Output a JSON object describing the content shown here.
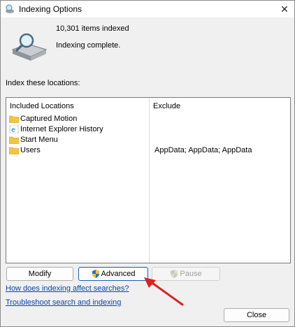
{
  "window": {
    "title": "Indexing Options",
    "close_glyph": "✕"
  },
  "status": {
    "items_indexed": "10,301 items indexed",
    "state": "Indexing complete."
  },
  "locations": {
    "label": "Index these locations:",
    "headers": {
      "included": "Included Locations",
      "exclude": "Exclude"
    },
    "rows": [
      {
        "name": "Captured Motion",
        "icon": "folder-icon",
        "exclude": ""
      },
      {
        "name": "Internet Explorer History",
        "icon": "internet-explorer-icon",
        "exclude": ""
      },
      {
        "name": "Start Menu",
        "icon": "folder-icon",
        "exclude": ""
      },
      {
        "name": "Users",
        "icon": "folder-icon",
        "exclude": "AppData; AppData; AppData"
      }
    ]
  },
  "buttons": {
    "modify": "Modify",
    "advanced": "Advanced",
    "pause": "Pause",
    "close": "Close"
  },
  "links": {
    "affect": "How does indexing affect searches?",
    "troubleshoot": "Troubleshoot search and indexing"
  },
  "colors": {
    "accent": "#1a5fb4",
    "link": "#0645ad",
    "arrow": "#e02020",
    "folder": "#f5c542"
  }
}
